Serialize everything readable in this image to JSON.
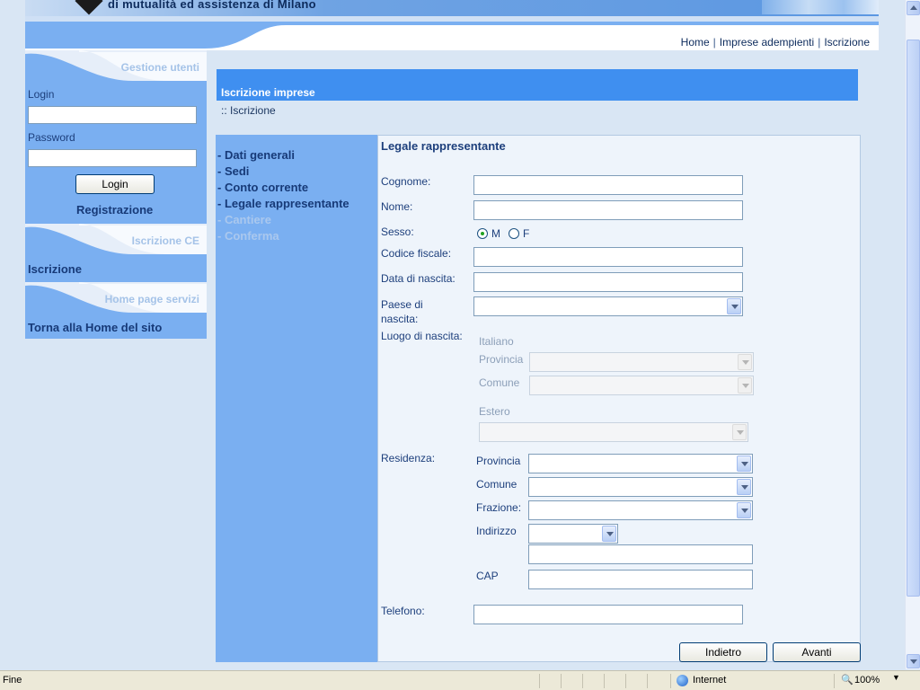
{
  "header": {
    "slogan": "di mutualità ed assistenza di Milano",
    "nav": [
      "Home",
      "Imprese adempienti",
      "Iscrizione"
    ]
  },
  "sidebar": {
    "section_users": "Gestione utenti",
    "login_label": "Login",
    "password_label": "Password",
    "login_button": "Login",
    "register_link": "Registrazione",
    "section_ce": "Iscrizione CE",
    "iscrizione_link": "Iscrizione",
    "section_services": "Home page servizi",
    "home_link": "Torna alla Home del sito"
  },
  "main": {
    "title": "Iscrizione imprese",
    "breadcrumb": ":: Iscrizione"
  },
  "steps": [
    {
      "label": "- Dati generali",
      "enabled": true
    },
    {
      "label": "- Sedi",
      "enabled": true
    },
    {
      "label": "- Conto corrente",
      "enabled": true
    },
    {
      "label": "- Legale rappresentante",
      "enabled": true
    },
    {
      "label": "- Cantiere",
      "enabled": false
    },
    {
      "label": "- Conferma",
      "enabled": false
    }
  ],
  "form": {
    "section_title": "Legale rappresentante",
    "cognome_label": "Cognome:",
    "nome_label": "Nome:",
    "sesso_label": "Sesso:",
    "sesso_options": [
      "M",
      "F"
    ],
    "sesso_selected": "M",
    "codice_fiscale_label": "Codice fiscale:",
    "data_nascita_label": "Data di nascita:",
    "paese_nascita_label": "Paese di nascita:",
    "luogo_nascita_label": "Luogo di nascita:",
    "italiano_label": "Italiano",
    "provincia_label": "Provincia",
    "comune_label": "Comune",
    "estero_label": "Estero",
    "residenza_label": "Residenza:",
    "frazione_label": "Frazione:",
    "indirizzo_label": "Indirizzo",
    "cap_label": "CAP",
    "telefono_label": "Telefono:",
    "back_button": "Indietro",
    "next_button": "Avanti"
  },
  "statusbar": {
    "status": "Fine",
    "zone": "Internet",
    "zoom": "100%"
  },
  "colors": {
    "sidebar": "#7aaff1",
    "title_bar": "#3f8ff0",
    "form_bg": "#eef4fb"
  }
}
